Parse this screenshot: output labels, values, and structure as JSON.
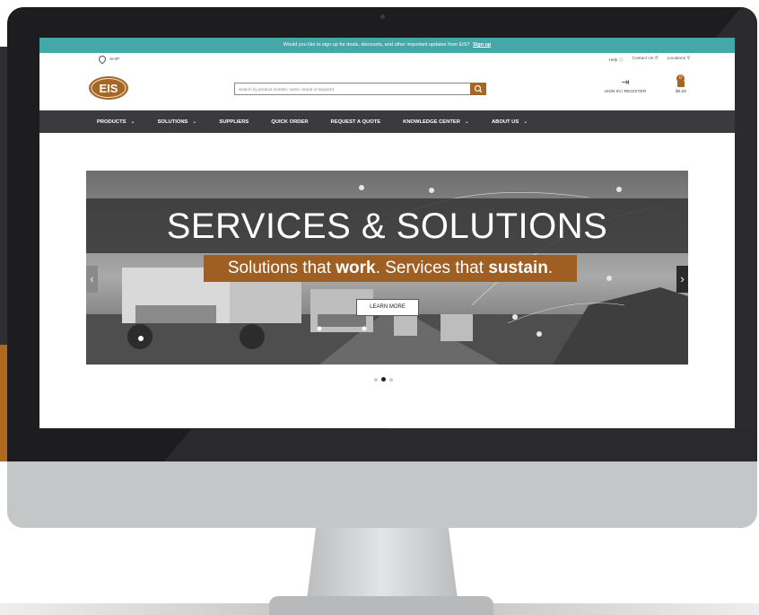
{
  "announcement": {
    "text": "Would you like to sign up for deals, discounts, and other important updates from EIS?",
    "link_label": "Sign up"
  },
  "topbar": {
    "ship_label": "SHIP",
    "help": "Help",
    "contact": "Contact Us",
    "locations": "Locations"
  },
  "header": {
    "logo_text": "EIS",
    "search_placeholder": "Search by product number, name, brand or keyword",
    "signin_label": "SIGN IN / REGISTER",
    "cart_total": "$0.00",
    "cart_count": "0"
  },
  "nav": [
    {
      "label": "PRODUCTS",
      "chev": "⌄"
    },
    {
      "label": "SOLUTIONS",
      "chev": "⌄"
    },
    {
      "label": "SUPPLIERS",
      "chev": ""
    },
    {
      "label": "QUICK ORDER",
      "chev": ""
    },
    {
      "label": "REQUEST A QUOTE",
      "chev": ""
    },
    {
      "label": "KNOWLEDGE CENTER",
      "chev": "⌄"
    },
    {
      "label": "ABOUT US",
      "chev": "⌄"
    }
  ],
  "hero": {
    "title": "SERVICES & SOLUTIONS",
    "sub_part1": "Solutions that ",
    "sub_bold1": "work",
    "sub_part2": ". Services that ",
    "sub_bold2": "sustain",
    "sub_part3": ".",
    "button": "LEARN MORE",
    "prev": "‹",
    "next": "›"
  },
  "carousel": {
    "slide_count": 3,
    "active_index": 1
  },
  "colors": {
    "teal": "#45a7a7",
    "brand_orange": "#a56626",
    "nav_dark": "#3b3b3d"
  }
}
